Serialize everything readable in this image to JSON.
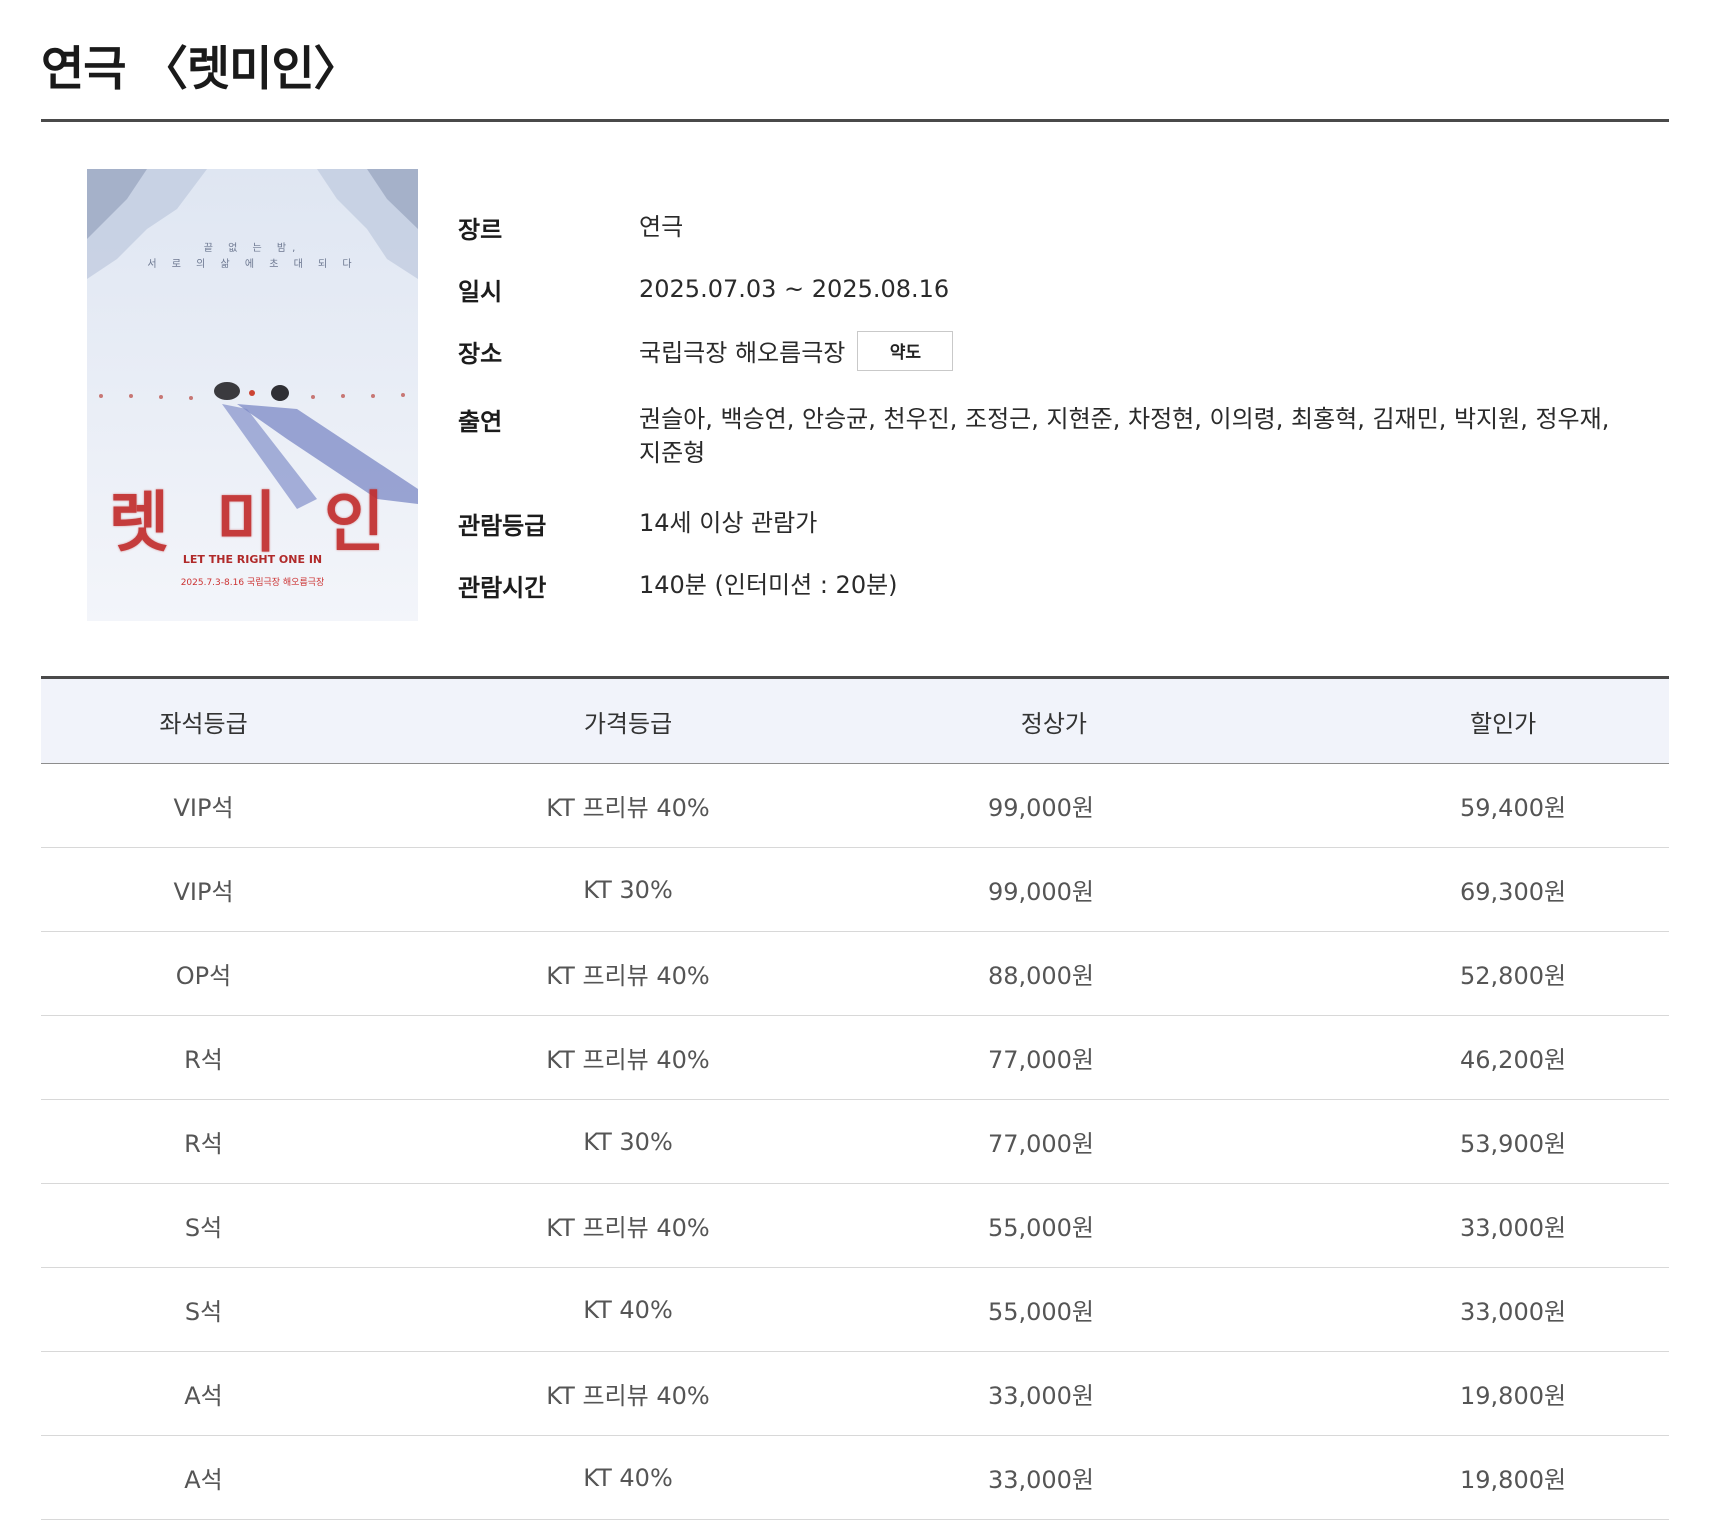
{
  "title": "연극 〈렛미인〉",
  "poster": {
    "title_text": "렛 미 인",
    "tagline_line1": "끝 없 는 밤,",
    "tagline_line2": "서 로 의 삶 에 초 대 되 다",
    "subtitle": "LET THE RIGHT ONE IN",
    "date_text": "2025.7.3-8.16 국립극장 해오름극장",
    "colors": {
      "snow": "#e9eef6",
      "shadow": "#6f7fbf",
      "title_red": "#c22d2d"
    }
  },
  "info": {
    "genre": {
      "label": "장르",
      "value": "연극"
    },
    "period": {
      "label": "일시",
      "value": "2025.07.03 ~ 2025.08.16"
    },
    "venue": {
      "label": "장소",
      "value": "국립극장 해오름극장",
      "map_button": "약도"
    },
    "cast": {
      "label": "출연",
      "value": "권슬아, 백승연, 안승균, 천우진, 조정근, 지현준, 차정현, 이의령, 최홍혁, 김재민, 박지원, 정우재, 지준형"
    },
    "rating": {
      "label": "관람등급",
      "value": "14세 이상 관람가"
    },
    "runtime": {
      "label": "관람시간",
      "value": "140분 (인터미션 : 20분)"
    }
  },
  "table": {
    "headers": {
      "seat": "좌석등급",
      "price_grade": "가격등급",
      "regular": "정상가",
      "discount": "할인가"
    },
    "rows": [
      {
        "seat": "VIP석",
        "price_grade": "KT 프리뷰 40%",
        "regular": "99,000원",
        "discount": "59,400원"
      },
      {
        "seat": "VIP석",
        "price_grade": "KT 30%",
        "regular": "99,000원",
        "discount": "69,300원"
      },
      {
        "seat": "OP석",
        "price_grade": "KT 프리뷰 40%",
        "regular": "88,000원",
        "discount": "52,800원"
      },
      {
        "seat": "R석",
        "price_grade": "KT 프리뷰 40%",
        "regular": "77,000원",
        "discount": "46,200원"
      },
      {
        "seat": "R석",
        "price_grade": "KT 30%",
        "regular": "77,000원",
        "discount": "53,900원"
      },
      {
        "seat": "S석",
        "price_grade": "KT 프리뷰 40%",
        "regular": "55,000원",
        "discount": "33,000원"
      },
      {
        "seat": "S석",
        "price_grade": "KT 40%",
        "regular": "55,000원",
        "discount": "33,000원"
      },
      {
        "seat": "A석",
        "price_grade": "KT 프리뷰 40%",
        "regular": "33,000원",
        "discount": "19,800원"
      },
      {
        "seat": "A석",
        "price_grade": "KT 40%",
        "regular": "33,000원",
        "discount": "19,800원"
      }
    ]
  }
}
